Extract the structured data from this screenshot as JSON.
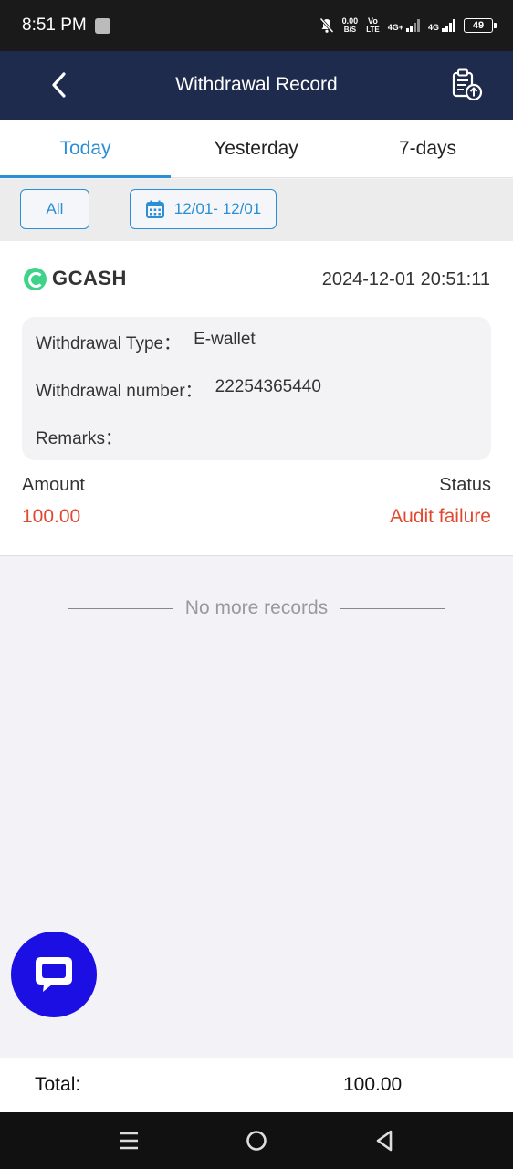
{
  "status_bar": {
    "time": "8:51 PM",
    "speed_value": "0.00",
    "speed_unit": "B/S",
    "volte_top": "Vo",
    "volte_bottom": "LTE",
    "network1": "4G+",
    "network2": "4G",
    "battery": "49"
  },
  "header": {
    "title": "Withdrawal Record",
    "back_icon": "chevron-left-icon",
    "action_icon": "clipboard-upload-icon"
  },
  "tabs": [
    {
      "label": "Today",
      "active": true
    },
    {
      "label": "Yesterday",
      "active": false
    },
    {
      "label": "7-days",
      "active": false
    }
  ],
  "filters": {
    "all_label": "All",
    "date_range": "12/01- 12/01",
    "date_icon": "calendar-icon"
  },
  "record": {
    "provider": "GCASH",
    "datetime": "2024-12-01 20:51:11",
    "type_label": "Withdrawal Type：",
    "type_value": "E-wallet",
    "number_label": "Withdrawal number：",
    "number_value": "22254365440",
    "remarks_label": "Remarks：",
    "remarks_value": "",
    "amount_label": "Amount",
    "amount_value": "100.00",
    "status_label": "Status",
    "status_value": "Audit failure"
  },
  "list_end": "No more records",
  "total": {
    "label": "Total:",
    "value": "100.00"
  },
  "colors": {
    "header_bg": "#1f2b4d",
    "accent": "#2a8fd4",
    "error": "#e0482f",
    "chat_fab": "#1c0fe3"
  }
}
